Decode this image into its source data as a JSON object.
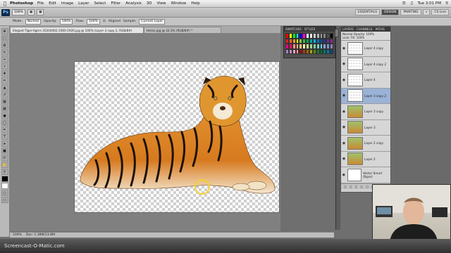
{
  "menubar": {
    "app_name": "Photoshop",
    "items": [
      "File",
      "Edit",
      "Image",
      "Layer",
      "Select",
      "Filter",
      "Analysis",
      "3D",
      "View",
      "Window",
      "Help"
    ],
    "clock": "Tue 3:01 PM"
  },
  "appbar": {
    "logo": "Ps",
    "zoom": "100%",
    "workspaces": [
      "ESSENTIALS",
      "DESIGN",
      "PAINTING"
    ],
    "active_workspace": "DESIGN",
    "cs_live": "CS Live"
  },
  "options": {
    "mode_label": "Mode:",
    "mode_value": "Normal",
    "opacity_label": "Opacity:",
    "opacity_value": "100%",
    "flow_label": "Flow:",
    "flow_value": "100%",
    "align_label": "Aligned",
    "sample_label": "Sample:",
    "sample_value": "Current Layer"
  },
  "document": {
    "title": "Elegant-Tiger-tigers-35204002-2560-1920.jpg @ 100% (Layer 3 copy 2, RGB/8#) *",
    "tabs": [
      "Elegant-Tiger-tigers-35204002-2560-1920.jpg @ 100% (Layer 3 copy 2, RGB/8#)",
      "Heron.jpg @ 33.3% (RGB/8#) *"
    ],
    "status_zoom": "100%",
    "status_doc": "Doc: 1.38M/13.8M"
  },
  "swatches": {
    "tabs": [
      "SWATCHES",
      "STYLES"
    ],
    "colors": [
      "#ff0000",
      "#ffff00",
      "#00ff00",
      "#00ffff",
      "#0000ff",
      "#ff00ff",
      "#ffffff",
      "#e6e6e6",
      "#cccccc",
      "#b3b3b3",
      "#999999",
      "#808080",
      "#4d4d4d",
      "#000000",
      "#ed1c24",
      "#f26522",
      "#f7941d",
      "#fff200",
      "#8dc63f",
      "#39b54a",
      "#00a651",
      "#00a99d",
      "#00aeef",
      "#0072bc",
      "#0054a6",
      "#2e3192",
      "#662d91",
      "#92278f",
      "#ec008c",
      "#ed145b",
      "#f69679",
      "#f9ad81",
      "#fdc689",
      "#fff799",
      "#c4df9b",
      "#a3d39c",
      "#82ca9c",
      "#7accc8",
      "#6dcff6",
      "#7da7d9",
      "#8393ca",
      "#8781bd",
      "#a186be",
      "#bd8cbf",
      "#f49ac2",
      "#f6989d",
      "#9e0b0f",
      "#a0410d",
      "#a36209",
      "#aba000",
      "#598527",
      "#1a7b30",
      "#007236",
      "#00746b",
      "#0076a3",
      "#004a80"
    ]
  },
  "layers": {
    "tabs": [
      "LAYERS",
      "CHANNELS",
      "PATHS"
    ],
    "blend_mode": "Normal",
    "opacity_label": "Opacity:",
    "opacity_value": "100%",
    "fill_label": "Fill:",
    "fill_value": "100%",
    "lock_label": "Lock:",
    "rows": [
      {
        "name": "Layer 4 copy",
        "thumb": "checker",
        "selected": false
      },
      {
        "name": "Layer 4 copy 2",
        "thumb": "checker",
        "selected": false
      },
      {
        "name": "Layer 4",
        "thumb": "checker",
        "selected": false
      },
      {
        "name": "Layer 3 copy 2",
        "thumb": "checker",
        "selected": true
      },
      {
        "name": "Layer 3 copy",
        "thumb": "photo",
        "selected": false
      },
      {
        "name": "Layer 3",
        "thumb": "photo",
        "selected": false
      },
      {
        "name": "Layer 2 copy",
        "thumb": "photo",
        "selected": false
      },
      {
        "name": "Layer 2",
        "thumb": "photo",
        "selected": false
      },
      {
        "name": "Vector Smart Object",
        "thumb": "doc",
        "selected": false
      }
    ]
  },
  "watermark": "Screencast-O-Matic.com"
}
